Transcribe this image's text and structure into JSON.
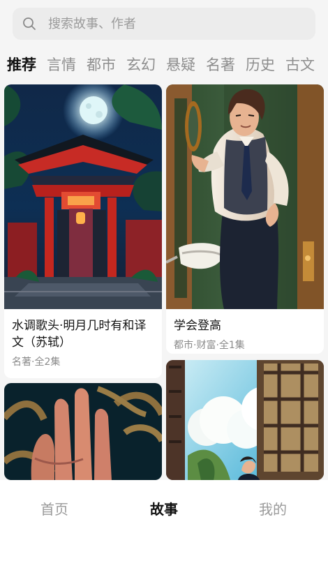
{
  "search": {
    "placeholder": "搜索故事、作者"
  },
  "categories": [
    "推荐",
    "言情",
    "都市",
    "玄幻",
    "悬疑",
    "名著",
    "历史",
    "古文"
  ],
  "cards": [
    {
      "title": "水调歌头·明月几时有和译文（苏轼）",
      "meta": "名著·全2集"
    },
    {
      "title": "学会登高",
      "meta": "都市·财富·全1集"
    }
  ],
  "nav": [
    "首页",
    "故事",
    "我的"
  ],
  "colors": {
    "background": "#f5f5f5",
    "search_background": "#ececec",
    "active_text": "#111111",
    "muted_text": "#8d8d8d"
  }
}
